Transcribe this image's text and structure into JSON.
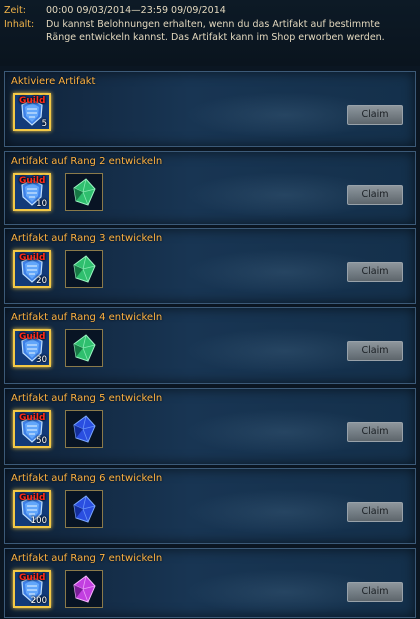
{
  "header": {
    "time_label": "Zeit:",
    "time_value": "00:00 09/03/2014—23:59 09/09/2014",
    "content_label": "Inhalt:",
    "content_value": "Du kannst Belohnungen erhalten, wenn du das Artifakt auf bestimmte Ränge entwickeln kannst. Das Artifakt kann im Shop erworben werden."
  },
  "tasks": [
    {
      "title": "Aktiviere Artifakt",
      "item_tag": "Guild",
      "qty": "5",
      "claim": "Claim",
      "gem": null
    },
    {
      "title": "Artifakt auf Rang 2 entwickeln",
      "item_tag": "Guild",
      "qty": "10",
      "claim": "Claim",
      "gem": "green"
    },
    {
      "title": "Artifakt auf Rang 3 entwickeln",
      "item_tag": "Guild",
      "qty": "20",
      "claim": "Claim",
      "gem": "green"
    },
    {
      "title": "Artifakt auf Rang 4 entwickeln",
      "item_tag": "Guild",
      "qty": "30",
      "claim": "Claim",
      "gem": "green"
    },
    {
      "title": "Artifakt auf Rang 5 entwickeln",
      "item_tag": "Guild",
      "qty": "50",
      "claim": "Claim",
      "gem": "blue"
    },
    {
      "title": "Artifakt auf Rang 6 entwickeln",
      "item_tag": "Guild",
      "qty": "100",
      "claim": "Claim",
      "gem": "blue"
    },
    {
      "title": "Artifakt auf Rang 7 entwickeln",
      "item_tag": "Guild",
      "qty": "200",
      "claim": "Claim",
      "gem": "purple"
    }
  ],
  "colors": {
    "title": "#ffb343",
    "guild_tag": "#ff2a1a",
    "green_gem": "#34d37a",
    "blue_gem": "#2a4ee0",
    "purple_gem": "#c23fe0"
  },
  "icons": {
    "guild_item": "blue-crystal-shield-icon",
    "green": "green-crystal-icon",
    "blue": "blue-crystal-icon",
    "purple": "purple-crystal-icon"
  }
}
